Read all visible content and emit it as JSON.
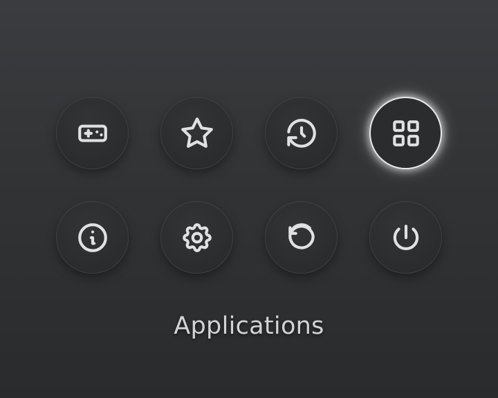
{
  "menu": {
    "items": [
      {
        "icon": "gamepad-icon",
        "selected": false
      },
      {
        "icon": "star-icon",
        "selected": false
      },
      {
        "icon": "history-icon",
        "selected": false
      },
      {
        "icon": "apps-grid-icon",
        "selected": true
      },
      {
        "icon": "info-icon",
        "selected": false
      },
      {
        "icon": "gear-icon",
        "selected": false
      },
      {
        "icon": "refresh-icon",
        "selected": false
      },
      {
        "icon": "power-icon",
        "selected": false
      }
    ],
    "selected_label": "Applications"
  },
  "colors": {
    "icon": "#e1e1e1",
    "selected_ring": "#e8e8e8",
    "caption": "#d4d4d4"
  }
}
